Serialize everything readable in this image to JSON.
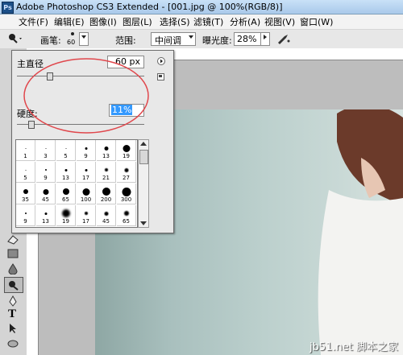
{
  "window": {
    "title": "Adobe Photoshop CS3 Extended - [001.jpg @ 100%(RGB/8)]",
    "app_icon": "Ps"
  },
  "menu": [
    "文件(F)",
    "编辑(E)",
    "图像(I)",
    "图层(L)",
    "选择(S)",
    "滤镜(T)",
    "分析(A)",
    "视图(V)",
    "窗口(W)"
  ],
  "options": {
    "brush_label": "画笔:",
    "brush_size": "60",
    "range_label": "范围:",
    "range_value": "中间调",
    "exposure_label": "曝光度:",
    "exposure_value": "28%"
  },
  "brush_panel": {
    "master_diameter_label": "主直径",
    "master_diameter_value": "60 px",
    "hardness_label": "硬度:",
    "hardness_value": "11%",
    "master_diameter_fraction": 0.25,
    "hardness_fraction": 0.11,
    "presets": [
      [
        "1",
        "3",
        "5",
        "9",
        "13",
        "19"
      ],
      [
        "5",
        "9",
        "13",
        "17",
        "21",
        "27"
      ],
      [
        "35",
        "45",
        "65",
        "100",
        "200",
        "300"
      ],
      [
        "9",
        "13",
        "19",
        "17",
        "45",
        "65"
      ]
    ]
  },
  "watermark": "jb51.net 脚本之家",
  "colors": {
    "highlight_ring": "#e0474c",
    "selected_text_bg": "#3399ff"
  }
}
